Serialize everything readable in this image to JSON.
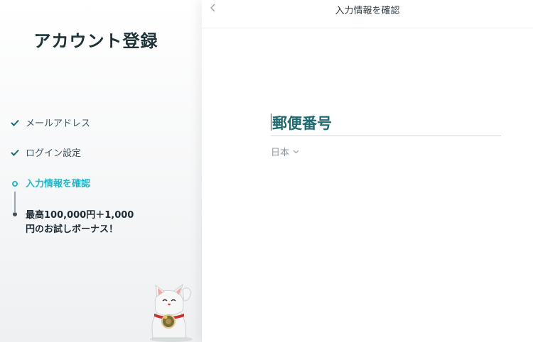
{
  "sidebar": {
    "title": "アカウント登録",
    "steps": [
      {
        "label": "メールアドレス",
        "status": "done"
      },
      {
        "label": "ログイン設定",
        "status": "done"
      },
      {
        "label": "入力情報を確認",
        "status": "active"
      },
      {
        "label": "最高100,000円＋1,000円のお試しボーナス！",
        "status": "upcoming"
      }
    ]
  },
  "topbar": {
    "back_icon": "chevron-left-icon",
    "title": "入力情報を確認"
  },
  "form": {
    "postal_code_label": "郵便番号",
    "country_value": "日本"
  },
  "colors": {
    "accent": "#21b6c9",
    "heading": "#1d6a70",
    "done_check": "#1d6a70"
  }
}
